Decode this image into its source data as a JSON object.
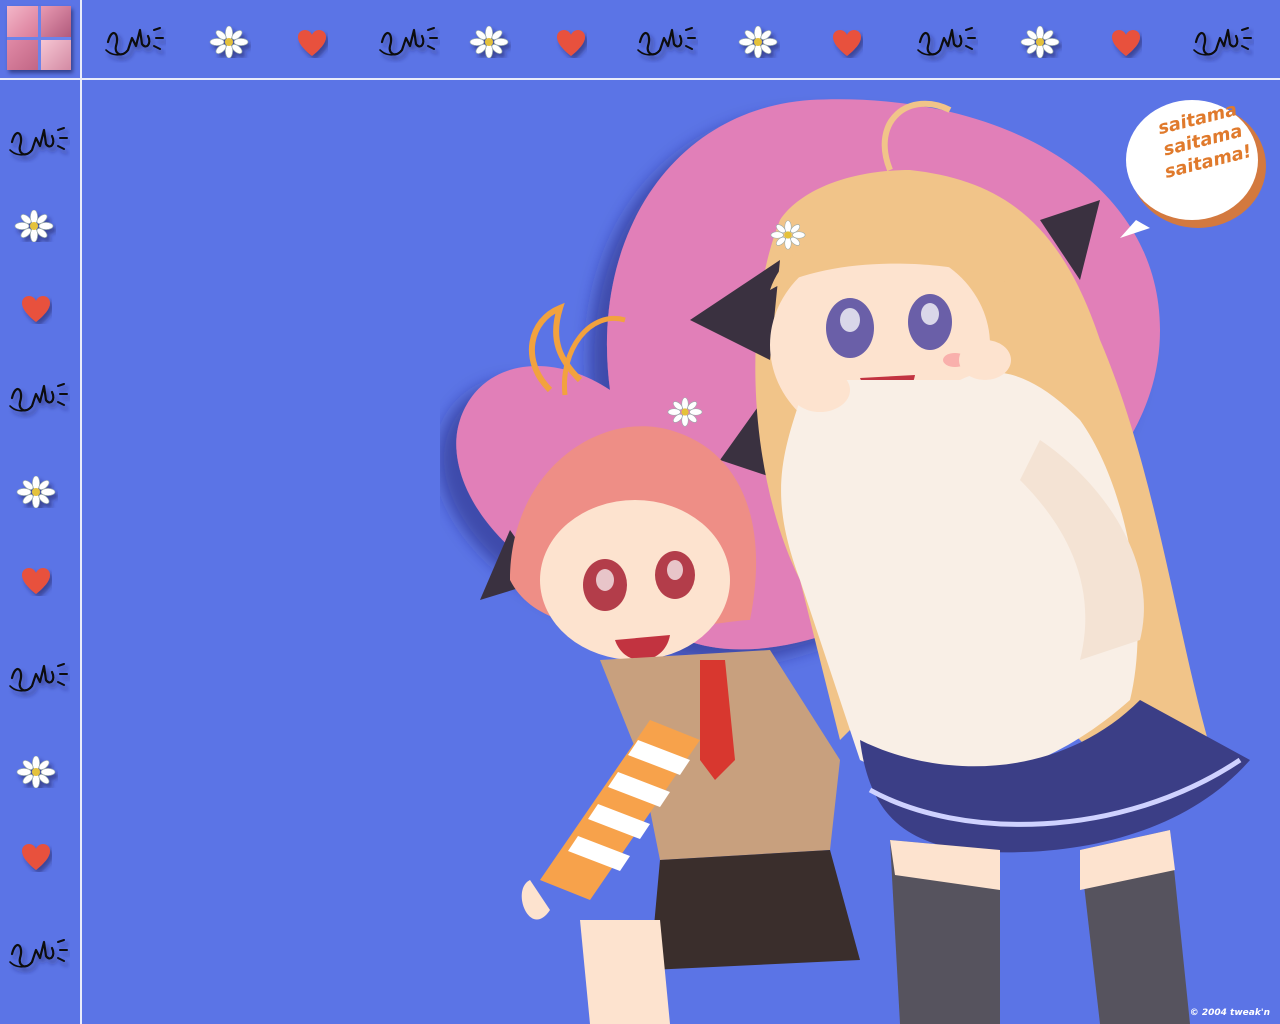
{
  "wallpaper": {
    "speech_bubble": {
      "lines": [
        "saitama",
        "saitama",
        "saitama!"
      ]
    },
    "copyright": "© 2004 tweak'n",
    "colors": {
      "background": "#5b74e6",
      "frame_line": "#e9ecfb",
      "heart_backdrop": "#e17fb8",
      "heart_icon": "#e8513c",
      "bubble_text": "#e07a2c"
    },
    "icons": {
      "border_pattern": [
        "bird-scribble-icon",
        "flower-icon",
        "heart-icon"
      ]
    }
  }
}
